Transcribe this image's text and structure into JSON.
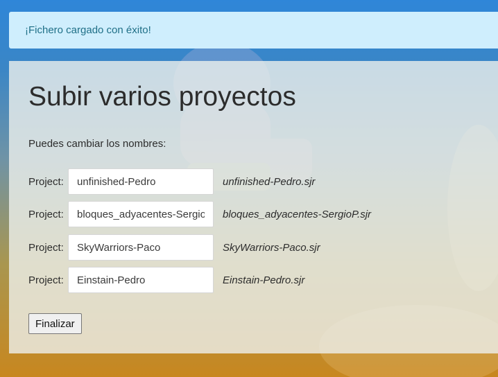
{
  "alert": {
    "message": "¡Fichero cargado con éxito!"
  },
  "page": {
    "title": "Subir varios proyectos",
    "hint": "Puedes cambiar los nombres:"
  },
  "projects": [
    {
      "label": "Project:",
      "value": "unfinished-Pedro",
      "filename": "unfinished-Pedro.sjr"
    },
    {
      "label": "Project:",
      "value": "bloques_adyacentes-SergioP",
      "filename": "bloques_adyacentes-SergioP.sjr"
    },
    {
      "label": "Project:",
      "value": "SkyWarriors-Paco",
      "filename": "SkyWarriors-Paco.sjr"
    },
    {
      "label": "Project:",
      "value": "Einstain-Pedro",
      "filename": "Einstain-Pedro.sjr"
    }
  ],
  "actions": {
    "finish_label": "Finalizar"
  },
  "colors": {
    "alert_bg": "#cfeefd",
    "alert_text": "#1f6f87",
    "header_blue": "#2f86d8",
    "bottom_orange": "#c8871f"
  }
}
